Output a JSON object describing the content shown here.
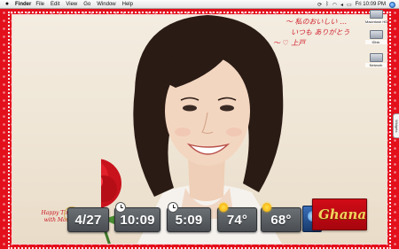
{
  "menubar": {
    "app": "Finder",
    "menus": [
      "File",
      "Edit",
      "View",
      "Go",
      "Window",
      "Help"
    ],
    "clock": "Fri 10:09 PM",
    "status_icons": [
      "sync-icon",
      "bluetooth-icon",
      "airport-icon",
      "volume-icon",
      "battery-icon"
    ]
  },
  "desktop_icons": [
    "Macintosh HD",
    "iDisk",
    "Network"
  ],
  "drawer_tab": "Widgets",
  "widgets": {
    "date": "4/27",
    "time1": "10:09",
    "time2": "5:09",
    "temp1": "74°",
    "temp2": "68°"
  },
  "colors": {
    "frame": "#e3101c",
    "widget": "#5a5f64",
    "accent_text": "#d2222e"
  }
}
